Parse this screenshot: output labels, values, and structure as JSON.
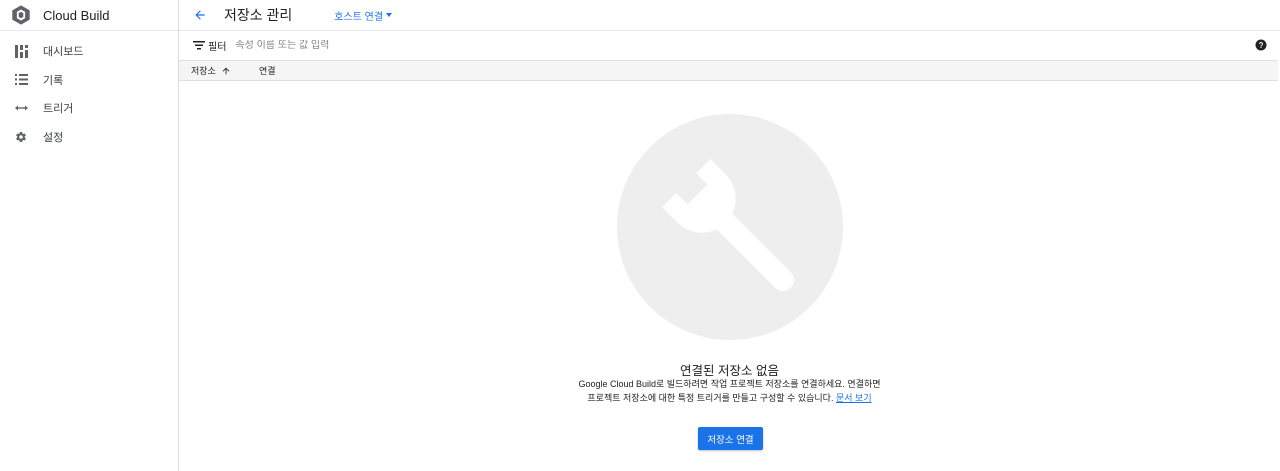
{
  "app": {
    "title": "Cloud Build"
  },
  "sidebar": {
    "items": [
      {
        "label": "대시보드",
        "icon": "dashboard-icon"
      },
      {
        "label": "기록",
        "icon": "list-icon"
      },
      {
        "label": "트리거",
        "icon": "trigger-arrows-icon"
      },
      {
        "label": "설정",
        "icon": "gear-icon"
      }
    ]
  },
  "header": {
    "title": "저장소 관리",
    "host_link": "호스트 연결"
  },
  "filter": {
    "label": "필터",
    "placeholder": "속성 이름 또는 값 입력"
  },
  "table": {
    "columns": [
      {
        "label": "저장소",
        "sorted": "asc"
      },
      {
        "label": "연결"
      }
    ]
  },
  "empty_state": {
    "title": "연결된 저장소 없음",
    "line1": "Google Cloud Build로 빌드하려면 작업 프로젝트 저장소를 연결하세요. 연결하면",
    "line2": "프로젝트 저장소에 대한 특정 트리거를 만들고 구성할 수 있습니다.",
    "doc_link": "문서 보기",
    "button": "저장소 연결"
  },
  "colors": {
    "accent": "#1a73e8",
    "illustration_bg": "#eeeeee"
  }
}
